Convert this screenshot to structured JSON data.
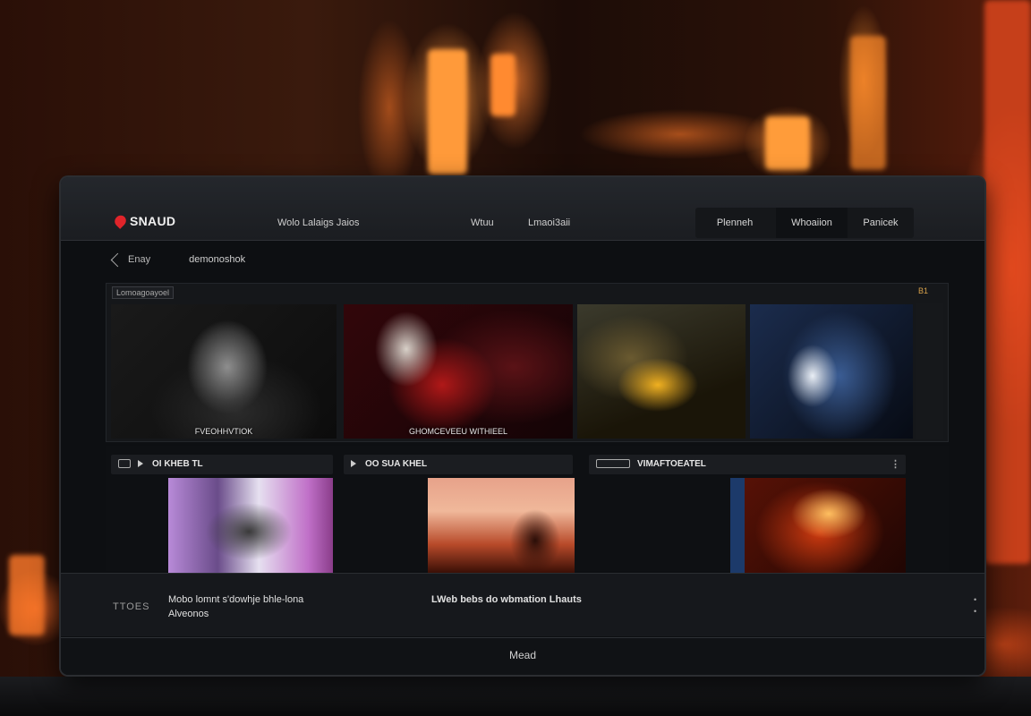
{
  "app": {
    "logo_text": "SNAUD"
  },
  "nav": {
    "links": [
      "Wolo Lalaigs Jaios",
      "Wtuu",
      "Lmaoi3aii"
    ],
    "buttons": [
      "Plenneh",
      "Whoaiion",
      "Panicek"
    ]
  },
  "subheader": {
    "back_label": "Enay",
    "title": "demonoshok"
  },
  "featured": {
    "title": "Lomoagoayoel",
    "badge": "B1",
    "items": [
      {
        "caption": "FVEOHHVTIOK",
        "icon": "hooded-figure-image"
      },
      {
        "caption": "GHOMCEVEEU WITHIEEL",
        "icon": "red-mask-image"
      },
      {
        "caption": "",
        "icon": "golden-dragon-image"
      },
      {
        "caption": "",
        "icon": "blue-hooded-figure-image"
      }
    ]
  },
  "row2": {
    "cards": [
      {
        "label": "OI KHEB TL"
      },
      {
        "label": "OO SUA KHEL"
      },
      {
        "label": "VIMAFTOEATEL",
        "more": "⋮"
      }
    ]
  },
  "info": {
    "badge": "TTOES",
    "line1": "Mobo lomnt s'dowhje bhle-lona",
    "line2": "Alveonos",
    "line3": "LWeb bebs do wbmation Lhauts",
    "more": "•\n•"
  },
  "footer": {
    "label": "Mead"
  },
  "colors": {
    "accent": "#e0242a",
    "badge": "#d6a04a"
  }
}
